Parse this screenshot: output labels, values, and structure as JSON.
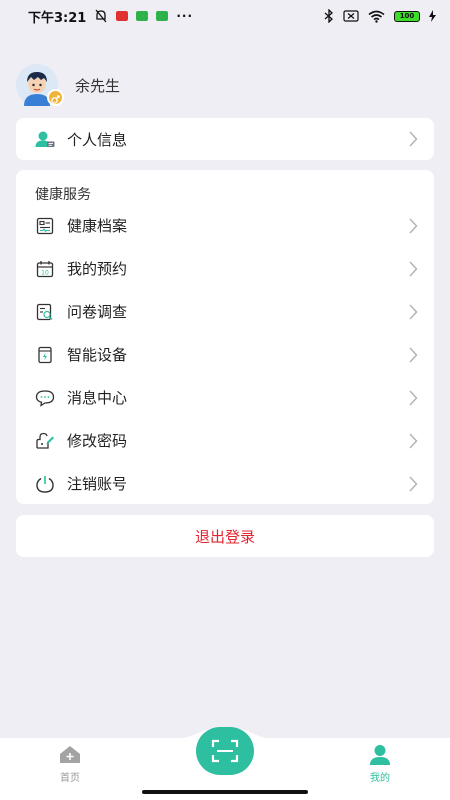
{
  "status_bar": {
    "time": "下午3:21",
    "dots": "···",
    "battery": "100"
  },
  "profile": {
    "name": "余先生"
  },
  "personal_info": {
    "label": "个人信息"
  },
  "health_services": {
    "title": "健康服务",
    "items": [
      {
        "label": "健康档案",
        "icon": "health-record-icon"
      },
      {
        "label": "我的预约",
        "icon": "calendar-icon"
      },
      {
        "label": "问卷调查",
        "icon": "survey-icon"
      },
      {
        "label": "智能设备",
        "icon": "smart-device-icon"
      },
      {
        "label": "消息中心",
        "icon": "message-icon"
      },
      {
        "label": "修改密码",
        "icon": "password-icon"
      },
      {
        "label": "注销账号",
        "icon": "power-icon"
      }
    ]
  },
  "logout": {
    "label": "退出登录"
  },
  "tabbar": {
    "home_label": "首页",
    "mine_label": "我的",
    "colors": {
      "active": "#2dbf9f",
      "inactive": "#999999"
    }
  }
}
